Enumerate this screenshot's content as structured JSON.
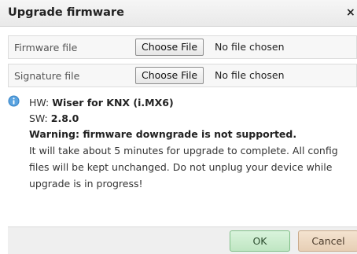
{
  "dialog": {
    "title": "Upgrade firmware",
    "close_symbol": "×"
  },
  "fields": [
    {
      "label": "Firmware file",
      "button_label": "Choose File",
      "status": "No file chosen"
    },
    {
      "label": "Signature file",
      "button_label": "Choose File",
      "status": "No file chosen"
    }
  ],
  "info": {
    "icon": "info-icon",
    "hw_label": "HW:",
    "hw_value": "Wiser for KNX (i.MX6)",
    "sw_label": "SW:",
    "sw_value": "2.8.0",
    "warning": "Warning: firmware downgrade is not supported.",
    "description": "It will take about 5 minutes for upgrade to complete. All config files will be kept unchanged. Do not unplug your device while upgrade is in progress!"
  },
  "buttons": {
    "ok": "OK",
    "cancel": "Cancel"
  },
  "colors": {
    "info_icon": "#3a86c8",
    "ok_bg": "#c8ebcb",
    "cancel_bg": "#ecd8c2"
  }
}
